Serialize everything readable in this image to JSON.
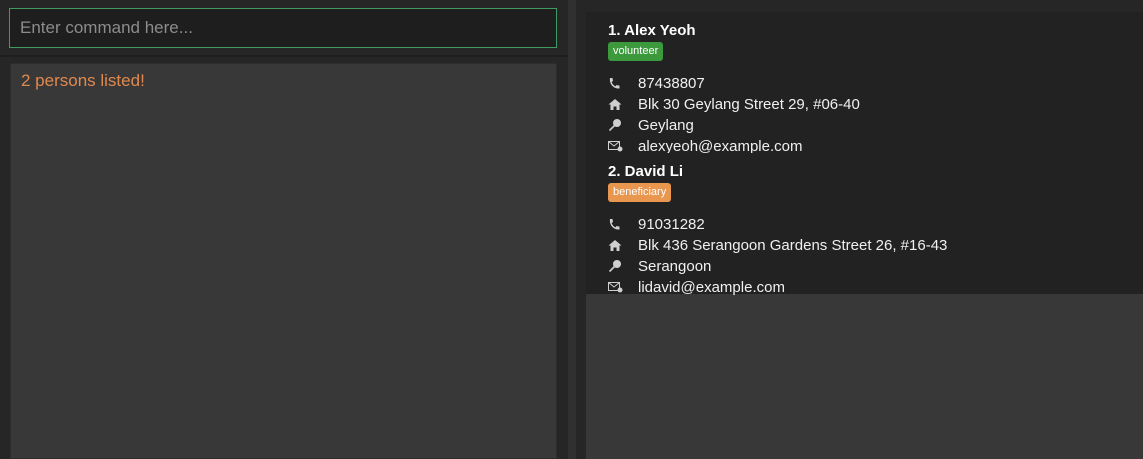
{
  "command": {
    "placeholder": "Enter command here...",
    "value": ""
  },
  "result": {
    "message": "2 persons listed!"
  },
  "colors": {
    "accent_border": "#3e9a62",
    "result_text": "#e0894f",
    "tag_volunteer": "#3c9a3c",
    "tag_beneficiary": "#e9964f"
  },
  "persons": [
    {
      "name": "1. Alex Yeoh",
      "tag": "volunteer",
      "phone": "87438807",
      "address": "Blk 30 Geylang Street 29, #06-40",
      "location": "Geylang",
      "email": "alexyeoh@example.com"
    },
    {
      "name": "2. David Li",
      "tag": "beneficiary",
      "phone": "91031282",
      "address": "Blk 436 Serangoon Gardens Street 26, #16-43",
      "location": "Serangoon",
      "email": "lidavid@example.com"
    }
  ],
  "icons": {
    "phone": "phone-icon",
    "address": "home-icon",
    "location": "pin-icon",
    "email": "mail-icon"
  }
}
